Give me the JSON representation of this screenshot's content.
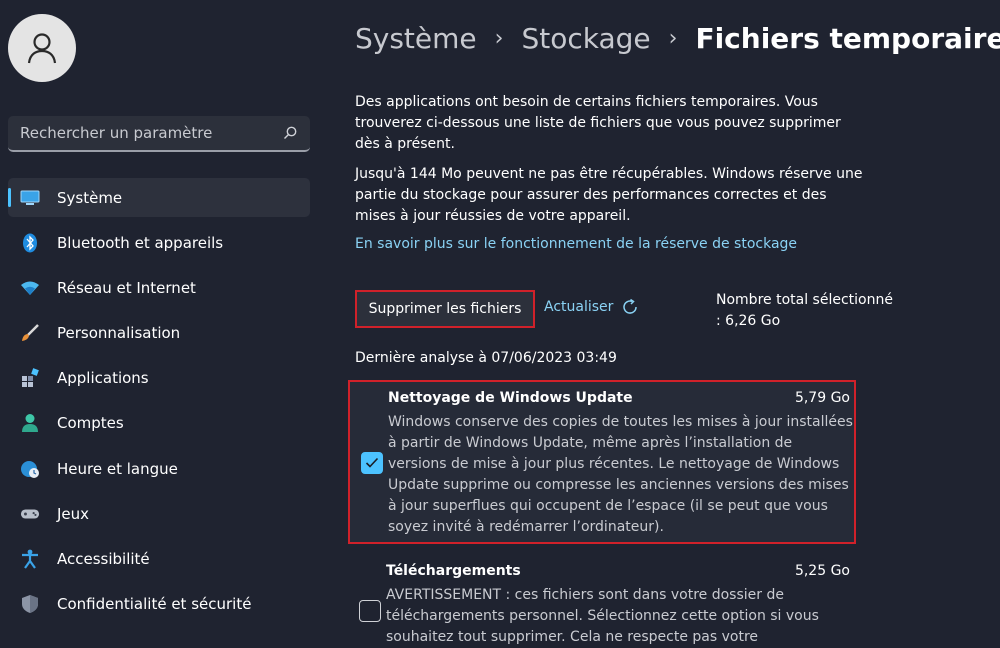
{
  "sidebar": {
    "search_placeholder": "Rechercher un paramètre",
    "items": [
      {
        "label": "Système",
        "icon": "monitor-icon",
        "active": true
      },
      {
        "label": "Bluetooth et appareils",
        "icon": "bluetooth-icon"
      },
      {
        "label": "Réseau et Internet",
        "icon": "wifi-icon"
      },
      {
        "label": "Personnalisation",
        "icon": "brush-icon"
      },
      {
        "label": "Applications",
        "icon": "apps-icon"
      },
      {
        "label": "Comptes",
        "icon": "person-icon"
      },
      {
        "label": "Heure et langue",
        "icon": "globe-clock-icon"
      },
      {
        "label": "Jeux",
        "icon": "gamepad-icon"
      },
      {
        "label": "Accessibilité",
        "icon": "accessibility-icon"
      },
      {
        "label": "Confidentialité et sécurité",
        "icon": "shield-icon"
      }
    ]
  },
  "breadcrumb": {
    "level1": "Système",
    "level2": "Stockage",
    "current": "Fichiers temporaires",
    "separator": "›"
  },
  "main": {
    "intro": "Des applications ont besoin de certains fichiers temporaires. Vous trouverez ci-dessous une liste de fichiers que vous pouvez supprimer dès à présent.",
    "reserve": "Jusqu'à 144 Mo peuvent ne pas être récupérables. Windows réserve une partie du stockage pour assurer des performances correctes et des mises à jour réussies de votre appareil.",
    "link": "En savoir plus sur le fonctionnement de la réserve de stockage",
    "delete_button": "Supprimer les fichiers",
    "refresh_button": "Actualiser",
    "total": "Nombre total sélectionné : 6,26 Go",
    "last_scan": "Dernière analyse à 07/06/2023 03:49",
    "items": [
      {
        "title": "Nettoyage de Windows Update",
        "size": "5,79 Go",
        "checked": true,
        "description": "Windows conserve des copies de toutes les mises à jour installées à partir de Windows Update, même après l’installation de versions de mise à jour plus récentes. Le nettoyage de Windows Update supprime ou compresse les anciennes versions des mises à jour superflues qui occupent de l’espace (il se peut que vous soyez invité à redémarrer l’ordinateur)."
      },
      {
        "title": "Téléchargements",
        "size": "5,25 Go",
        "checked": false,
        "description": "AVERTISSEMENT : ces fichiers sont dans votre dossier de téléchargements personnel. Sélectionnez cette option si vous souhaitez tout supprimer. Cela ne respecte pas votre"
      }
    ]
  },
  "colors": {
    "accent": "#4cc2ff",
    "highlight_border": "#d0212a",
    "background": "#1f2330",
    "link": "#8ad2f4"
  }
}
